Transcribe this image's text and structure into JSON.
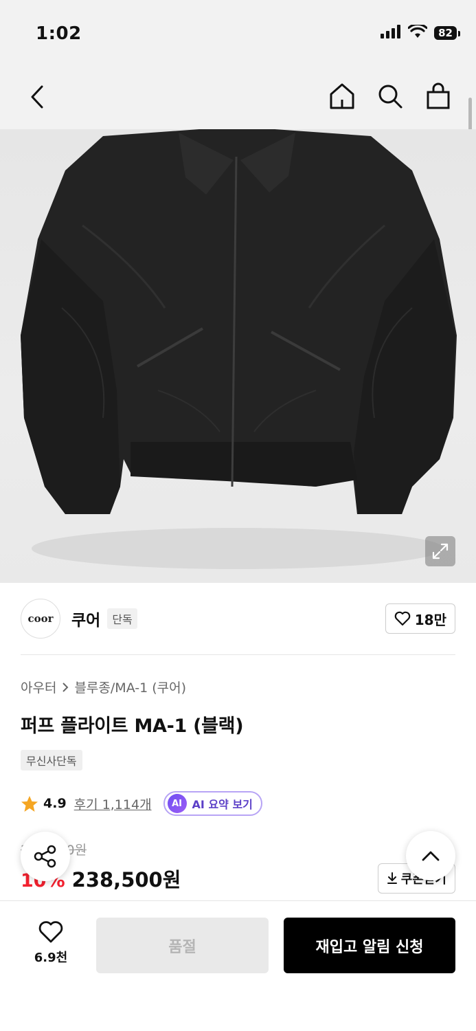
{
  "status_bar": {
    "time": "1:02",
    "battery": "82"
  },
  "brand": {
    "logo_text": "coor",
    "name": "쿠어",
    "tag": "단독",
    "likes": "18만"
  },
  "breadcrumb": {
    "category": "아우터",
    "subcategory": "블루종/MA-1 (쿠어)"
  },
  "product": {
    "title": "퍼프 플라이트 MA-1 (블랙)",
    "exclusive_badge": "무신사단독",
    "rating": "4.9",
    "reviews_label": "후기 1,114개",
    "ai_badge": "AI",
    "ai_summary_label": "AI 요약 보기",
    "original_price": "265,000원",
    "discount": "10%",
    "price": "238,500원",
    "coupon_label": "쿠폰받기"
  },
  "bottom_bar": {
    "wish_count": "6.9천",
    "soldout_label": "품절",
    "restock_label": "재입고 알림 신청"
  },
  "colors": {
    "accent_red": "#f3212f",
    "ai_purple": "#6f4ff2",
    "star": "#f5a623"
  }
}
